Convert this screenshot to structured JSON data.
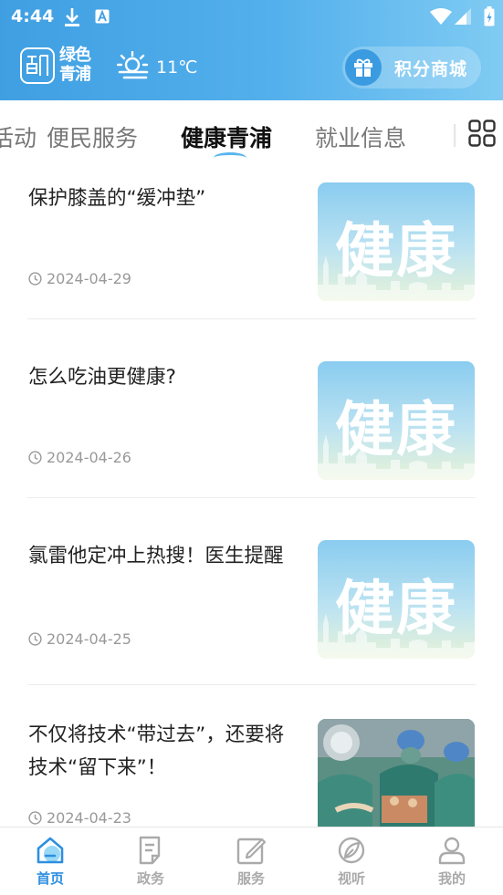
{
  "status_bar": {
    "time": "4:44",
    "icons": [
      "download-icon",
      "a-icon",
      "wifi-icon",
      "signal-icon",
      "battery-icon"
    ]
  },
  "header": {
    "logo_text": "绿色青浦",
    "logo_text_line1": "绿色",
    "logo_text_line2": "青浦",
    "temperature": "11℃",
    "weather_icon": "partly-sunny-icon",
    "mall_label": "积分商城",
    "mall_icon": "gift-icon"
  },
  "tabs": [
    {
      "label": "便民服务",
      "active": false
    },
    {
      "label": "健康青浦",
      "active": true
    },
    {
      "label": "就业信息",
      "active": false
    }
  ],
  "tabs_partial": {
    "left": "活动",
    "right": "|"
  },
  "articles": [
    {
      "title": "保护膝盖的“缓冲垫”",
      "date": "2024-04-29",
      "thumbnail": "健康"
    },
    {
      "title": "怎么吃油更健康?",
      "date": "2024-04-26",
      "thumbnail": "健康"
    },
    {
      "title": "氯雷他定冲上热搜！医生提醒",
      "date": "2024-04-25",
      "thumbnail": "健康"
    },
    {
      "title": "不仅将技术“带过去”，还要将技术“留下来”！",
      "date": "2024-04-23",
      "thumbnail": ""
    }
  ],
  "bottom_nav": [
    {
      "label": "首页",
      "icon": "home-icon",
      "active": true
    },
    {
      "label": "政务",
      "icon": "document-icon",
      "active": false
    },
    {
      "label": "服务",
      "icon": "edit-icon",
      "active": false
    },
    {
      "label": "视听",
      "icon": "leaf-icon",
      "active": false
    },
    {
      "label": "我的",
      "icon": "user-icon",
      "active": false
    }
  ],
  "colors": {
    "primary": "#3F9FE2",
    "header_end": "#7FCBF3",
    "active_nav": "#2E8FE0",
    "inactive_text": "#AAAAAA"
  }
}
